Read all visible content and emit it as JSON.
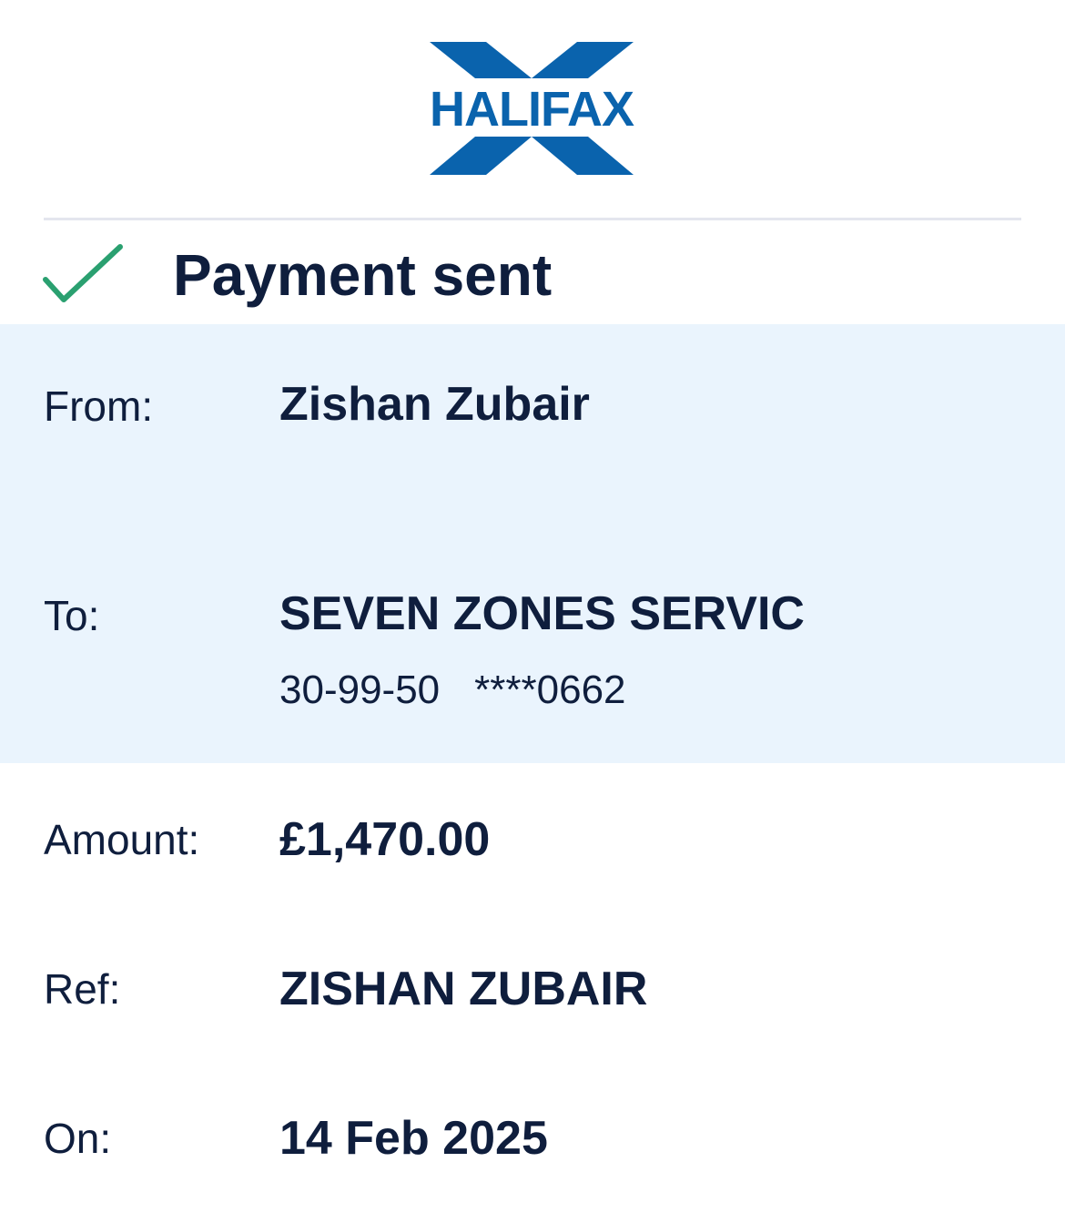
{
  "brand": {
    "name": "HALIFAX",
    "color": "#0a63ad"
  },
  "status": {
    "icon": "checkmark-icon",
    "icon_color": "#2aa070",
    "title": "Payment sent"
  },
  "details": {
    "from": {
      "label": "From:",
      "value": "Zishan Zubair"
    },
    "to": {
      "label": "To:",
      "value": "SEVEN ZONES SERVIC",
      "sort_code": "30-99-50",
      "account_number": "****0662"
    },
    "amount": {
      "label": "Amount:",
      "value": "£1,470.00"
    },
    "ref": {
      "label": "Ref:",
      "value": "ZISHAN ZUBAIR"
    },
    "on": {
      "label": "On:",
      "value": "14 Feb 2025"
    }
  },
  "colors": {
    "text": "#0f1e3d",
    "highlight_bg": "#eaf4fd",
    "divider": "#e4e6ee"
  }
}
